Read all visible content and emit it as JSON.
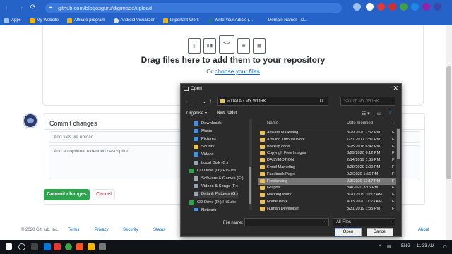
{
  "browser": {
    "url": "github.com/blogosguru/digimade/upload",
    "bookmarks": [
      "Apps",
      "My Website",
      "Affiliate program",
      "Android Visualizer",
      "Important Work",
      "Write Your Article (...",
      "Domain Names | D..."
    ]
  },
  "upload": {
    "drag_text": "Drag files here to add them to your repository",
    "or_text": "Or",
    "choose_link": "choose your files"
  },
  "commit": {
    "title": "Commit changes",
    "message_placeholder": "Add files via upload",
    "description_placeholder": "Add an optional extended description...",
    "commit_button": "Commit changes",
    "cancel_button": "Cancel"
  },
  "footer": {
    "copyright": "© 2020 GitHub, Inc.",
    "links": [
      "Terms",
      "Privacy",
      "Security",
      "Status",
      "About"
    ]
  },
  "dialog": {
    "title": "Open",
    "path": [
      "DATA",
      "MY WORK"
    ],
    "search_placeholder": "Search MY WORK",
    "organize": "Organise",
    "new_folder": "New folder",
    "columns": {
      "name": "Name",
      "date": "Date modified",
      "type": "T"
    },
    "nav_items": [
      {
        "label": "Downloads",
        "color": "#4a90d9"
      },
      {
        "label": "Music",
        "color": "#4a90d9"
      },
      {
        "label": "Pictures",
        "color": "#4a90d9"
      },
      {
        "label": "Sourav",
        "color": "#e8c15a"
      },
      {
        "label": "Videos",
        "color": "#4a90d9"
      },
      {
        "label": "Local Disk (C:)",
        "color": "#9aa4ad"
      },
      {
        "label": "CD Drive (D:) HiSuite",
        "color": "#2ea44f"
      },
      {
        "label": "Software & Games (E:)",
        "color": "#9aa4ad"
      },
      {
        "label": "Videos & Songs (F:)",
        "color": "#9aa4ad"
      },
      {
        "label": "Data & Pictures (G:)",
        "color": "#9aa4ad"
      },
      {
        "label": "CD Drive (D:) HiSuite",
        "color": "#2ea44f"
      },
      {
        "label": "Network",
        "color": "#4a90d9"
      }
    ],
    "files": [
      {
        "name": "Affiliate Marketing",
        "date": "8/29/2020 7:52 PM",
        "type": "F"
      },
      {
        "name": "Arduino Tutorial Work",
        "date": "7/31/2017 3:31 PM",
        "type": "F"
      },
      {
        "name": "Backup code",
        "date": "3/25/2018 6:42 PM",
        "type": "F"
      },
      {
        "name": "Copyrigh Free Images",
        "date": "8/29/2020 6:12 PM",
        "type": "F"
      },
      {
        "name": "DAILYMOTION",
        "date": "2/14/2019 1:35 PM",
        "type": "F"
      },
      {
        "name": "Email Marketing",
        "date": "8/29/2020 3:00 PM",
        "type": "F"
      },
      {
        "name": "Facebook Page",
        "date": "9/2/2020 1:56 PM",
        "type": "F"
      },
      {
        "name": "Freelancing",
        "date": "9/3/2020 12:17 PM",
        "type": "F",
        "selected": true
      },
      {
        "name": "Graphic",
        "date": "8/4/2020 3:15 PM",
        "type": "F"
      },
      {
        "name": "Hacking Work",
        "date": "8/20/2019 10:17 AM",
        "type": "F"
      },
      {
        "name": "Home Work",
        "date": "4/13/2020 11:23 AM",
        "type": "F"
      },
      {
        "name": "Human Developer",
        "date": "8/31/2019 1:35 PM",
        "type": "F"
      }
    ],
    "filename_label": "File name:",
    "filetype": "All Files",
    "open_button": "Open",
    "cancel_button": "Cancel"
  },
  "taskbar": {
    "language": "ENG",
    "time": "11:33 AM"
  }
}
